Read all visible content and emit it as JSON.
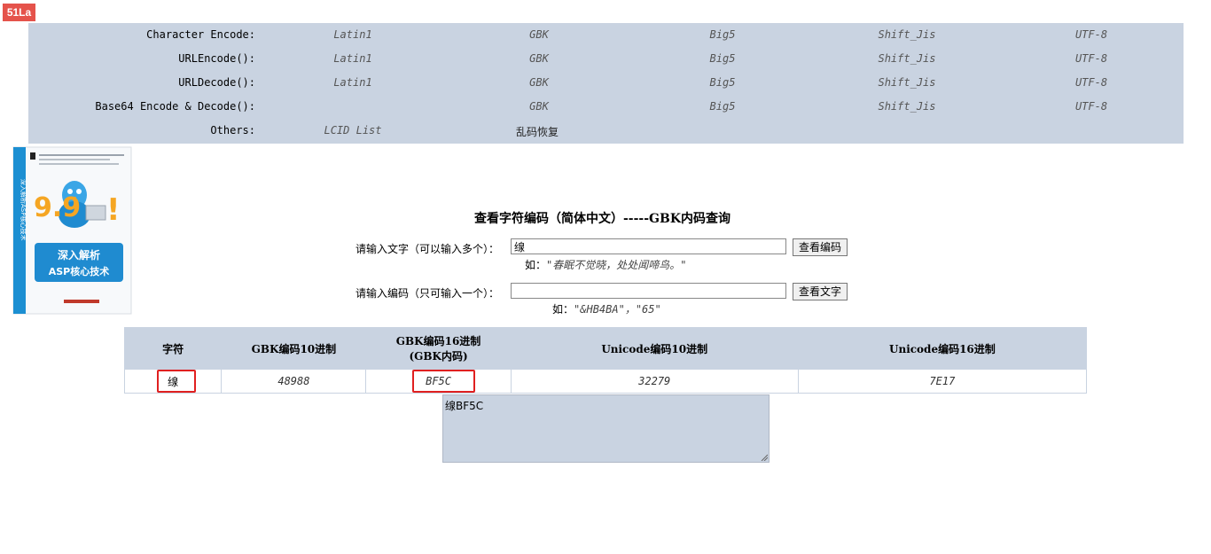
{
  "badge": "51La",
  "nav": {
    "rows": [
      {
        "label": "Character Encode:",
        "links": [
          "Latin1",
          "GBK",
          "Big5",
          "Shift_Jis",
          "UTF-8"
        ]
      },
      {
        "label": "URLEncode():",
        "links": [
          "Latin1",
          "GBK",
          "Big5",
          "Shift_Jis",
          "UTF-8"
        ]
      },
      {
        "label": "URLDecode():",
        "links": [
          "Latin1",
          "GBK",
          "Big5",
          "Shift_Jis",
          "UTF-8"
        ]
      },
      {
        "label": "Base64 Encode & Decode():",
        "links": [
          "",
          "GBK",
          "Big5",
          "Shift_Jis",
          "UTF-8"
        ]
      },
      {
        "label": "Others:",
        "links": [
          "LCID List",
          "乱码恢复"
        ]
      }
    ]
  },
  "book": {
    "big_number": "9.9",
    "exclaim": "!",
    "title_line1": "深入解析",
    "title_line2": "ASP核心技术",
    "spine": "深入解析ASP核心技术"
  },
  "page_title": "查看字符编码（简体中文）-----GBK内码查询",
  "form": {
    "text_label": "请输入文字（可以输入多个）：",
    "text_value": "缐",
    "text_button": "查看编码",
    "text_hint_prefix": "如：",
    "text_hint_example": "\"春眠不觉晓，处处闻啼鸟。\"",
    "code_label": "请输入编码（只可输入一个）：",
    "code_value": "",
    "code_button": "查看文字",
    "code_hint_prefix": "如：",
    "code_hint_example": "\"&HB4BA\"，\"65\""
  },
  "table": {
    "headers": [
      "字符",
      "GBK编码10进制",
      "GBK编码16进制",
      "(GBK内码)",
      "Unicode编码10进制",
      "Unicode编码16进制"
    ],
    "row": {
      "char": "缐",
      "gbk_dec": "48988",
      "gbk_hex": "BF5C",
      "uni_dec": "32279",
      "uni_hex": "7E17"
    }
  },
  "output": "缐BF5C",
  "colors": {
    "panel": "#c9d3e1",
    "highlight": "#e02020",
    "badge": "#e5534b"
  }
}
